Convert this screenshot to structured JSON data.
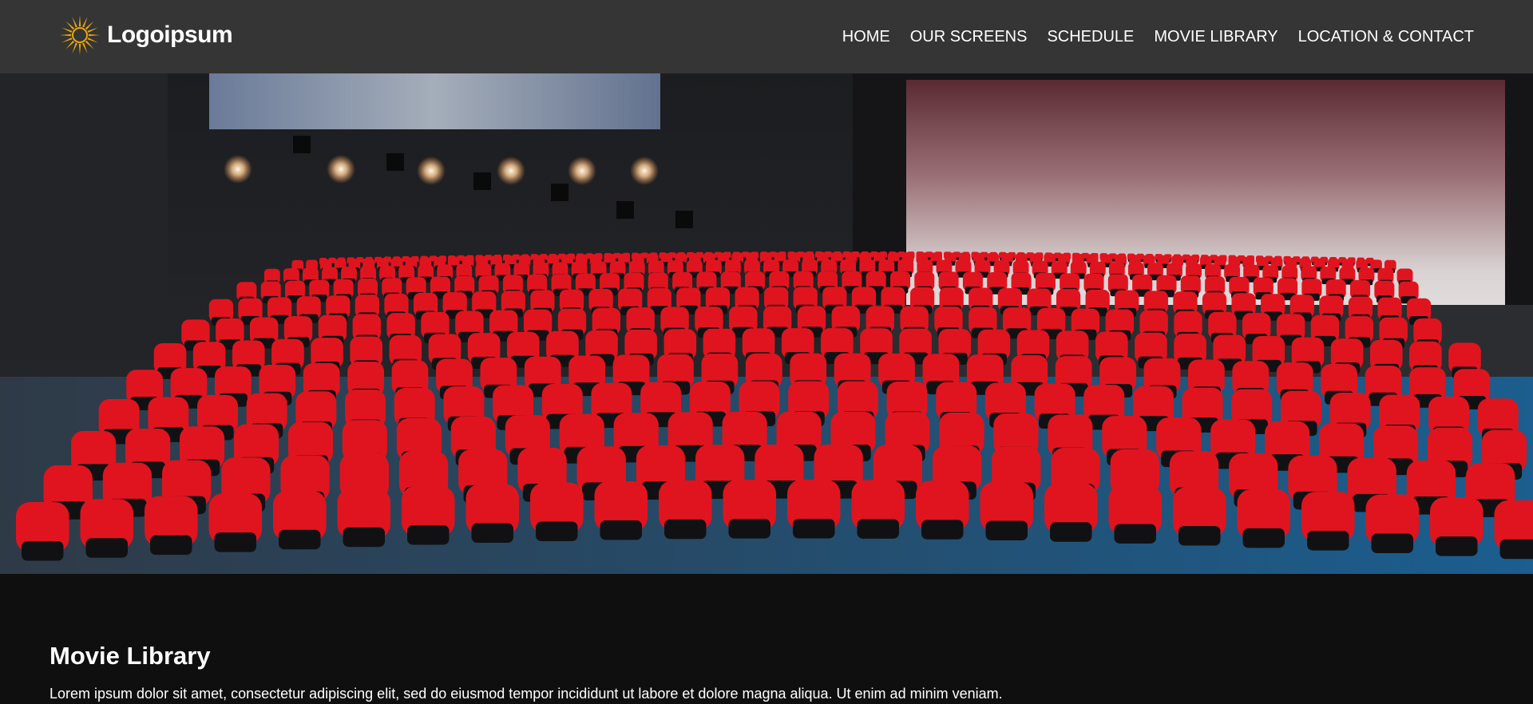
{
  "brand": {
    "name": "Logoipsum",
    "icon": "sunburst-logo-icon",
    "accent_color": "#e8a411"
  },
  "nav": {
    "items": [
      {
        "label": "HOME"
      },
      {
        "label": "OUR SCREENS"
      },
      {
        "label": "SCHEDULE"
      },
      {
        "label": "MOVIE LIBRARY"
      },
      {
        "label": "LOCATION & CONTACT"
      }
    ]
  },
  "hero": {
    "image": "cinema-auditorium-photo",
    "seat_color": "#e0141f"
  },
  "main": {
    "title": "Movie Library",
    "intro": "Lorem ipsum dolor sit amet, consectetur adipiscing elit, sed do eiusmod tempor incididunt ut labore et dolore magna aliqua. Ut enim ad minim veniam."
  },
  "colors": {
    "header_bg": "#353535",
    "page_bg": "#0f0f0f"
  }
}
